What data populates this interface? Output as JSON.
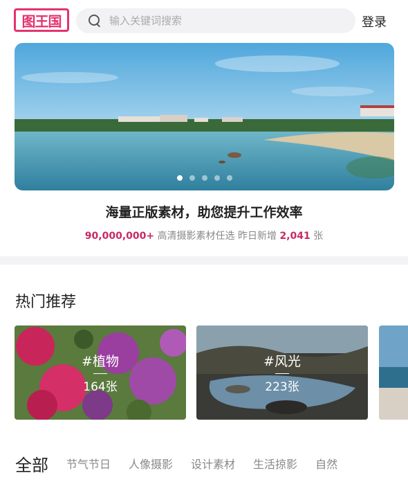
{
  "header": {
    "logo_text": "图王国",
    "search_placeholder": "输入关键词搜索",
    "login_label": "登录"
  },
  "banner": {
    "slide_count": 5,
    "active_slide": 0
  },
  "slogan": "海量正版素材，助您提升工作效率",
  "stats": {
    "count": "90,000,000+",
    "text1": " 高清摄影素材任选 昨日新增 ",
    "new_count": "2,041",
    "text2": " 张"
  },
  "hot": {
    "title": "热门推荐",
    "cards": [
      {
        "tag": "#植物",
        "count": "164张"
      },
      {
        "tag": "#风光",
        "count": "223张"
      }
    ]
  },
  "tabs": {
    "all_label": "全部",
    "items": [
      "节气节日",
      "人像摄影",
      "设计素材",
      "生活掠影",
      "自然"
    ]
  },
  "colors": {
    "accent": "#e5326e",
    "highlight": "#c72a64"
  }
}
